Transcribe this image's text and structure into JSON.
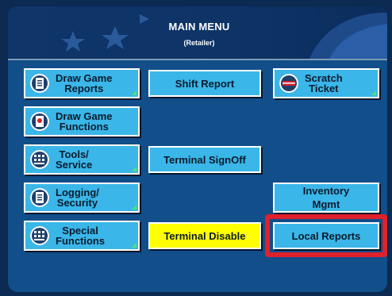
{
  "header": {
    "title": "MAIN MENU",
    "subtitle": "(Retailer)"
  },
  "left_column": [
    {
      "name": "draw-game-reports",
      "line1": "Draw Game",
      "line2": "Reports",
      "icon": "document-icon"
    },
    {
      "name": "draw-game-functions",
      "line1": "Draw Game",
      "line2": "Functions",
      "icon": "ticket-icon"
    },
    {
      "name": "tools-service",
      "line1": "Tools/",
      "line2": "Service",
      "icon": "keypad-icon"
    },
    {
      "name": "logging-security",
      "line1": "Logging/",
      "line2": "Security",
      "icon": "document-icon"
    },
    {
      "name": "special-functions",
      "line1": "Special",
      "line2": "Functions",
      "icon": "keypad-icon"
    }
  ],
  "middle_column": [
    {
      "name": "shift-report",
      "label": "Shift Report"
    },
    {
      "name": "terminal-signoff",
      "label": "Terminal SignOff"
    },
    {
      "name": "terminal-disable",
      "label": "Terminal Disable",
      "color": "#ffff00"
    }
  ],
  "right_column": [
    {
      "name": "scratch-ticket",
      "line1": "Scratch",
      "line2": "Ticket",
      "icon": "scratch-icon"
    },
    {
      "name": "inventory-mgmt",
      "line1": "Inventory",
      "line2": "Mgmt"
    },
    {
      "name": "local-reports",
      "label": "Local Reports",
      "highlighted": true
    }
  ],
  "colors": {
    "button": "#3ab6e8",
    "background": "#114e8a",
    "header": "#0f3569",
    "highlight": "#e0202a",
    "yellow": "#ffff00"
  }
}
